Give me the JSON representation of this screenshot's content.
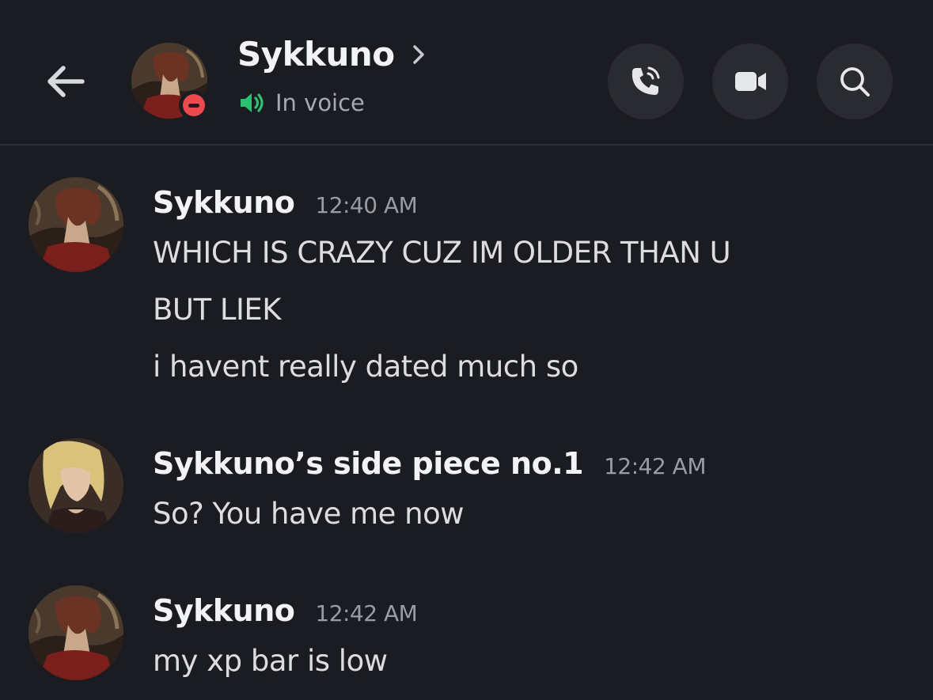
{
  "header": {
    "title": "Sykkuno",
    "status_text": "In voice",
    "status": "do-not-disturb",
    "icons": {
      "back": "arrow-left-icon",
      "chevron": "chevron-right-icon",
      "voice": "speaker-icon",
      "call": "phone-call-icon",
      "video": "video-camera-icon",
      "search": "search-icon"
    }
  },
  "messages": [
    {
      "author": "Sykkuno",
      "time": "12:40 AM",
      "lines": [
        "WHICH IS CRAZY CUZ IM OLDER THAN U",
        "BUT LIEK",
        "i havent really dated much so"
      ]
    },
    {
      "author": "Sykkuno’s side piece no.1",
      "time": "12:42 AM",
      "lines": [
        "So? You have me now"
      ]
    },
    {
      "author": "Sykkuno",
      "time": "12:42 AM",
      "lines": [
        "my xp bar is low"
      ]
    }
  ],
  "colors": {
    "background": "#1b1c21",
    "button_bg": "#2a2b31",
    "dnd_red": "#ec4a4d",
    "voice_green": "#2fbf71",
    "muted_text": "#a7a9b1"
  }
}
